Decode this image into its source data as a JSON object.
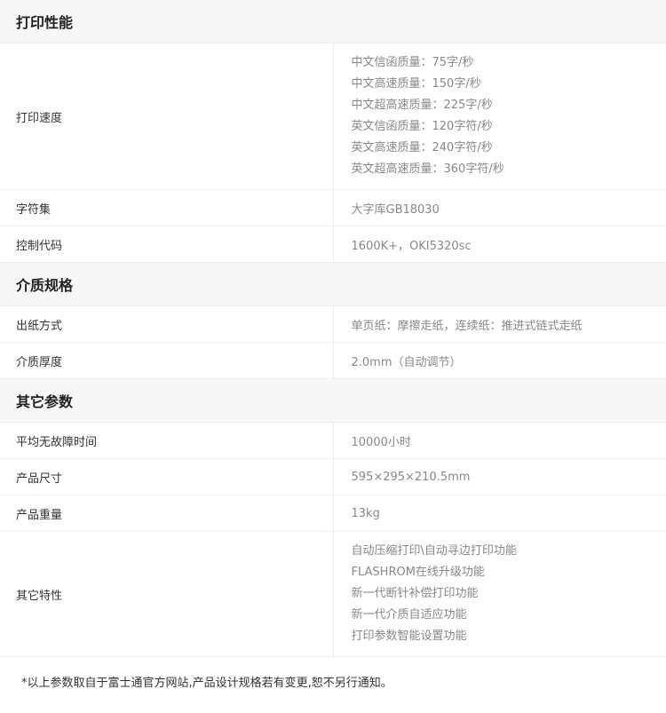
{
  "sections": [
    {
      "title": "打印性能",
      "rows": [
        {
          "label": "打印速度",
          "values": [
            "中文信函质量：75字/秒",
            "中文高速质量：150字/秒",
            "中文超高速质量：225字/秒",
            "英文信函质量：120字符/秒",
            "英文高速质量：240字符/秒",
            "英文超高速质量：360字符/秒"
          ]
        },
        {
          "label": "字符集",
          "values": [
            "大字库GB18030"
          ]
        },
        {
          "label": "控制代码",
          "values": [
            "1600K+，OKI5320sc"
          ]
        }
      ]
    },
    {
      "title": "介质规格",
      "rows": [
        {
          "label": "出纸方式",
          "values": [
            "单页纸：摩擦走纸，连续纸：推进式链式走纸"
          ]
        },
        {
          "label": "介质厚度",
          "values": [
            "2.0mm（自动调节）"
          ]
        }
      ]
    },
    {
      "title": "其它参数",
      "rows": [
        {
          "label": "平均无故障时间",
          "values": [
            "10000小时"
          ]
        },
        {
          "label": "产品尺寸",
          "values": [
            "595×295×210.5mm"
          ]
        },
        {
          "label": "产品重量",
          "values": [
            "13kg"
          ]
        },
        {
          "label": "其它特性",
          "values": [
            "自动压缩打印\\自动寻边打印功能",
            "FLASHROM在线升级功能",
            "新一代断针补偿打印功能",
            "新一代介质自适应功能",
            "打印参数智能设置功能"
          ]
        }
      ]
    }
  ],
  "footnote": "*以上参数取自于富士通官方网站,产品设计规格若有变更,恕不另行通知。"
}
